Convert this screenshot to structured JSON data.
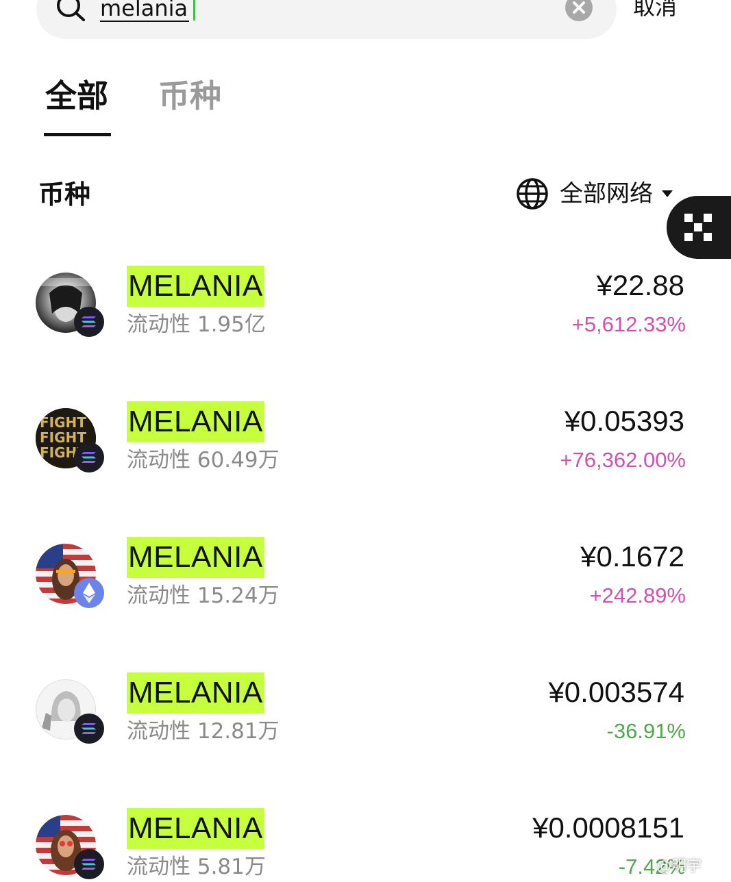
{
  "search": {
    "value": "melania",
    "cancel_label": "取消"
  },
  "tabs": [
    {
      "label": "全部",
      "active": true
    },
    {
      "label": "币种",
      "active": false
    }
  ],
  "section": {
    "title": "币种",
    "network_filter_label": "全部网络"
  },
  "colors": {
    "highlight": "#c6ff3b",
    "positive": "#d44fae",
    "negative": "#4fa84a",
    "caret": "#3cbf4d"
  },
  "tokens": [
    {
      "name": "MELANIA",
      "liquidity": "流动性 1.95亿",
      "price": "¥22.88",
      "change": "+5,612.33%",
      "direction": "up",
      "chain": "solana-icon"
    },
    {
      "name": "MELANIA",
      "liquidity": "流动性 60.49万",
      "price": "¥0.05393",
      "change": "+76,362.00%",
      "direction": "up",
      "chain": "solana-icon"
    },
    {
      "name": "MELANIA",
      "liquidity": "流动性 15.24万",
      "price": "¥0.1672",
      "change": "+242.89%",
      "direction": "up",
      "chain": "ethereum-icon"
    },
    {
      "name": "MELANIA",
      "liquidity": "流动性 12.81万",
      "price": "¥0.003574",
      "change": "-36.91%",
      "direction": "down",
      "chain": "solana-icon"
    },
    {
      "name": "MELANIA",
      "liquidity": "流动性 5.81万",
      "price": "¥0.0008151",
      "change": "-7.42%",
      "direction": "down",
      "chain": "solana-icon"
    }
  ],
  "watermark": "@明宇"
}
